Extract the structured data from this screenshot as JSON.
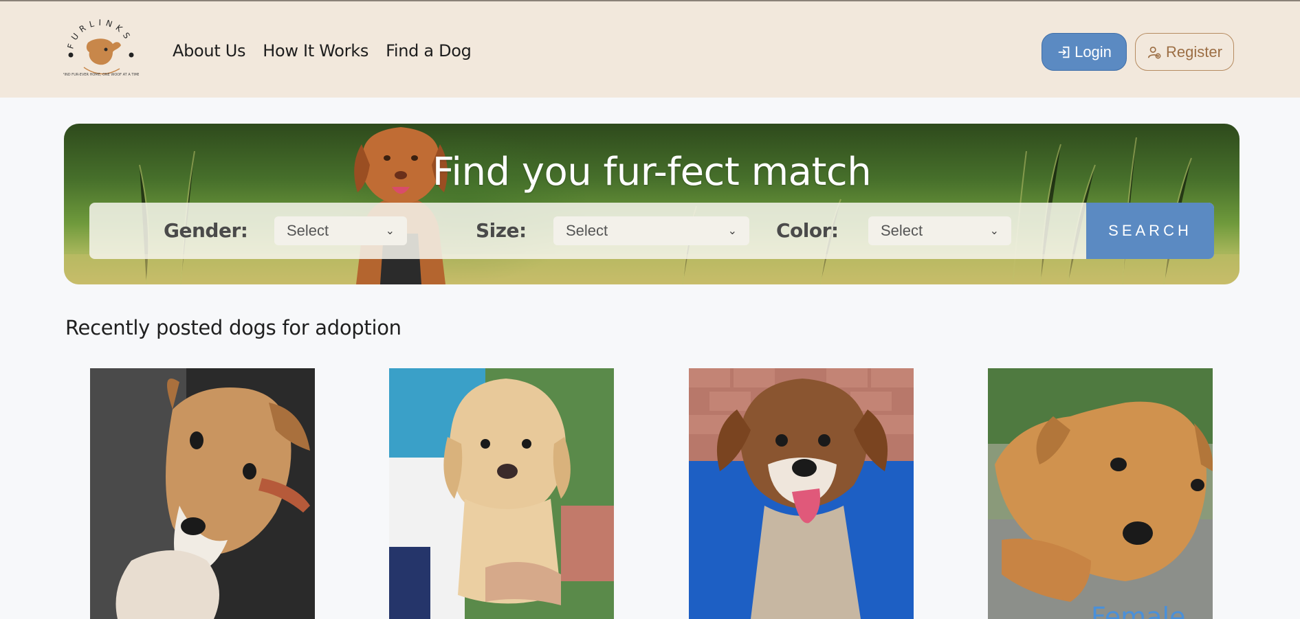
{
  "brand": {
    "name": "FURLINKS",
    "tagline": "FIND FUR-EVER HOME, ONE WOOF AT A TIME"
  },
  "nav": [
    {
      "label": "About Us"
    },
    {
      "label": "How It Works"
    },
    {
      "label": "Find a Dog"
    }
  ],
  "auth": {
    "login_label": "Login",
    "register_label": "Register"
  },
  "hero": {
    "title": "Find you fur-fect match",
    "filters": {
      "gender": {
        "label": "Gender:",
        "value": "Select"
      },
      "size": {
        "label": "Size:",
        "value": "Select"
      },
      "color": {
        "label": "Color:",
        "value": "Select"
      }
    },
    "search_label": "SEARCH"
  },
  "recent": {
    "title": "Recently posted dogs for adoption",
    "cards": [
      {
        "gender": ""
      },
      {
        "gender": ""
      },
      {
        "gender": ""
      },
      {
        "gender": "Female"
      }
    ]
  },
  "colors": {
    "accent": "#5b8ac2",
    "header_bg": "#f2e8dc",
    "brand_brown": "#b58a5f"
  },
  "icons": {
    "login": "login-arrow-icon",
    "register": "user-add-icon",
    "dropdown": "chevron-down-icon"
  }
}
